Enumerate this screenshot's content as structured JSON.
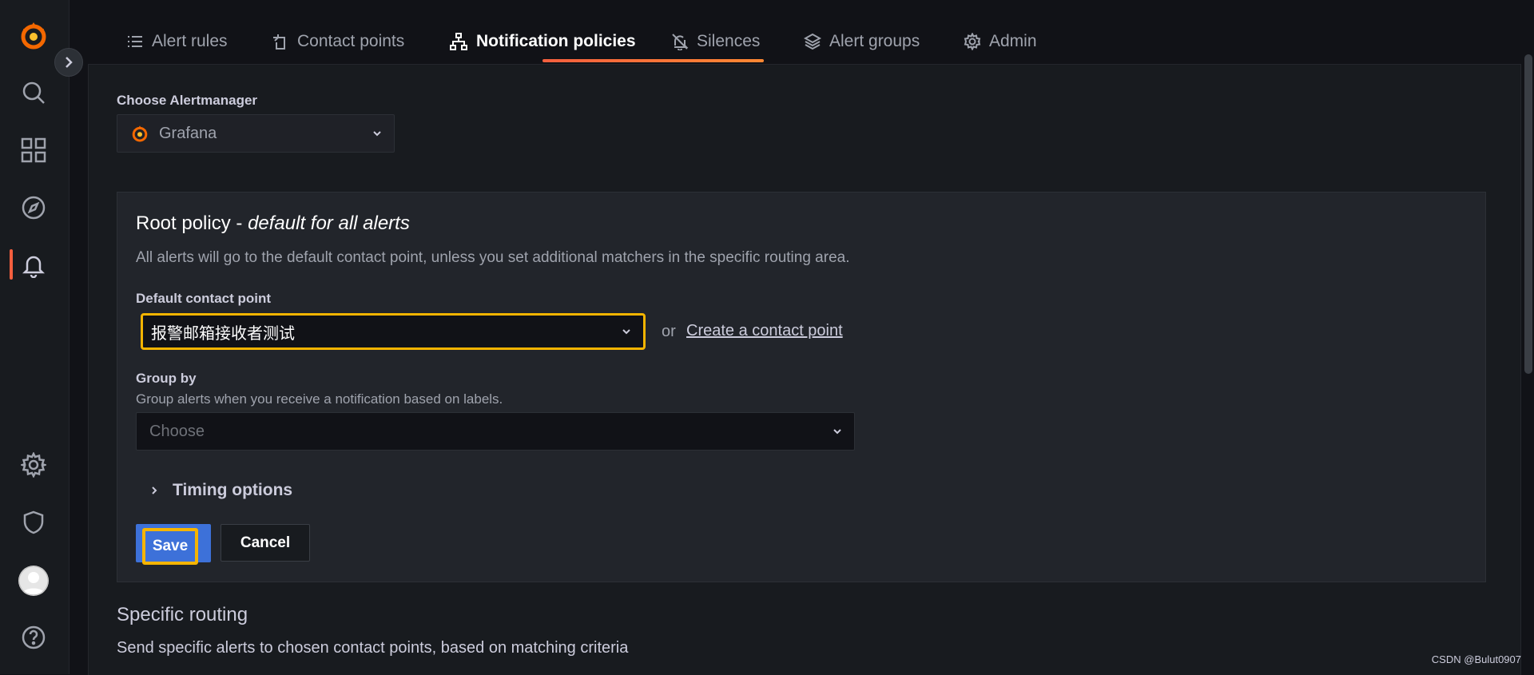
{
  "tabs": [
    {
      "label": "Alert rules",
      "icon": "list-icon"
    },
    {
      "label": "Contact points",
      "icon": "contact-icon"
    },
    {
      "label": "Notification policies",
      "icon": "sitemap-icon"
    },
    {
      "label": "Silences",
      "icon": "bell-slash-icon"
    },
    {
      "label": "Alert groups",
      "icon": "layers-icon"
    },
    {
      "label": "Admin",
      "icon": "cog-icon"
    }
  ],
  "active_tab": "Notification policies",
  "alertmanager": {
    "label": "Choose Alertmanager",
    "selected": "Grafana"
  },
  "root_policy": {
    "title_main": "Root policy - ",
    "title_italic": "default for all alerts",
    "description": "All alerts will go to the default contact point, unless you set additional matchers in the specific routing area.",
    "contact_point_label": "Default contact point",
    "contact_point_value": "报警邮箱接收者测试",
    "or_text": "or",
    "create_link": "Create a contact point",
    "group_by_label": "Group by",
    "group_by_desc": "Group alerts when you receive a notification based on labels.",
    "group_by_placeholder": "Choose",
    "timing_label": "Timing options",
    "save_label": "Save",
    "cancel_label": "Cancel"
  },
  "specific_routing": {
    "title": "Specific routing",
    "description": "Send specific alerts to chosen contact points, based on matching criteria"
  },
  "watermark": "CSDN @Bulut0907",
  "colors": {
    "accent": "#f55f3e",
    "highlight": "#f5b400",
    "primary_button": "#3d71d9"
  }
}
